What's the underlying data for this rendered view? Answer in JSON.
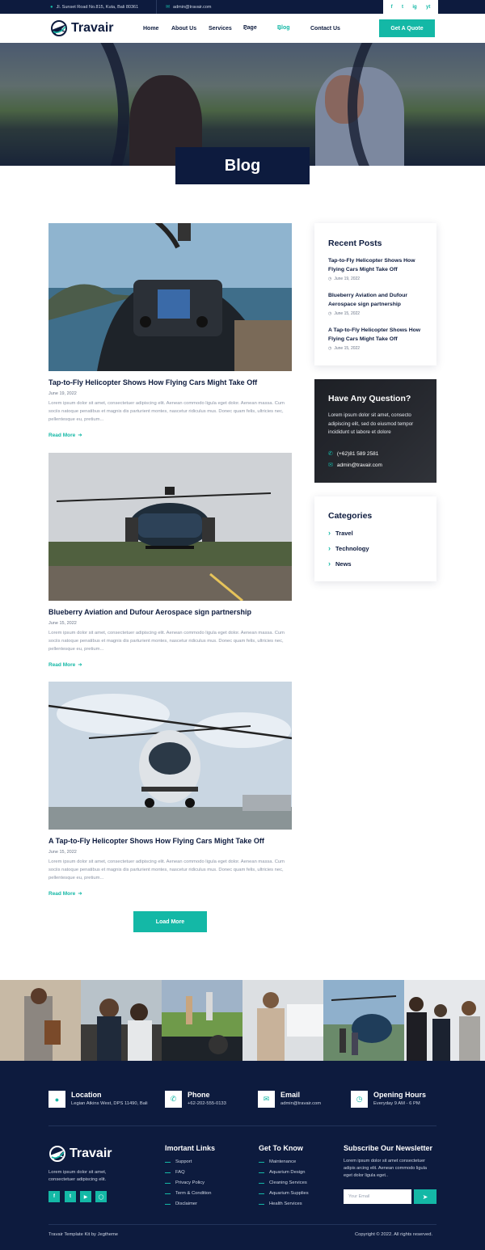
{
  "topbar": {
    "address": "Jl. Sunset Road No.815, Kuta, Bali 80361",
    "email": "admin@travair.com",
    "social": [
      "f",
      "t",
      "ig",
      "yt"
    ]
  },
  "nav": {
    "logo": "Travair",
    "items": [
      "Home",
      "About Us",
      "Services",
      "Page",
      "Blog",
      "Contact Us"
    ],
    "active": "Blog",
    "quote_button": "Get A Quote"
  },
  "hero": {
    "title": "Blog"
  },
  "posts": [
    {
      "title": "Tap-to-Fly Helicopter Shows How Flying Cars Might Take Off",
      "date": "June 19, 2022",
      "excerpt": "Lorem ipsum dolor sit amet, consectetuer adipiscing elit. Aenean commodo ligula eget dolor. Aenean massa. Cum sociis natoque penatibus et magnis dis parturient montes, nascetur ridiculus mus. Donec quam felis, ultricies nec, pellentesque eu, pretium...",
      "read_more": "Read More"
    },
    {
      "title": "Blueberry Aviation and Dufour Aerospace sign partnership",
      "date": "June 15, 2022",
      "excerpt": "Lorem ipsum dolor sit amet, consectetuer adipiscing elit. Aenean commodo ligula eget dolor. Aenean massa. Cum sociis natoque penatibus et magnis dis parturient montes, nascetur ridiculus mus. Donec quam felis, ultricies nec, pellentesque eu, pretium...",
      "read_more": "Read More"
    },
    {
      "title": "A Tap-to-Fly Helicopter Shows How Flying Cars Might Take Off",
      "date": "June 15, 2022",
      "excerpt": "Lorem ipsum dolor sit amet, consectetuer adipiscing elit. Aenean commodo ligula eget dolor. Aenean massa. Cum sociis natoque penatibus et magnis dis parturient montes, nascetur ridiculus mus. Donec quam felis, ultricies nec, pellentesque eu, pretium...",
      "read_more": "Read More"
    }
  ],
  "load_more": "Load More",
  "sidebar": {
    "recent_title": "Recent Posts",
    "recent": [
      {
        "title": "Tap-to-Fly Helicopter Shows How Flying Cars Might Take Off",
        "date": "June 19, 2022"
      },
      {
        "title": "Blueberry Aviation and Dufour Aerospace sign partnership",
        "date": "June 15, 2022"
      },
      {
        "title": "A Tap-to-Fly Helicopter Shows How Flying Cars Might Take Off",
        "date": "June 15, 2022"
      }
    ],
    "question": {
      "title": "Have Any Question?",
      "text": "Lorem ipsum dolor sit amet, consecto adipiscing elit, sed do eiusmod tempor incididunt ut labore et dolore",
      "phone": "(+62)81 589 2581",
      "email": "admin@travair.com"
    },
    "categories_title": "Categories",
    "categories": [
      "Travel",
      "Technology",
      "News"
    ]
  },
  "footer": {
    "info": [
      {
        "title": "Location",
        "text": "Legian Atkins West, DPS 11490, Bali",
        "icon": "location-icon"
      },
      {
        "title": "Phone",
        "text": "+62-202-555-0133",
        "icon": "phone-icon"
      },
      {
        "title": "Email",
        "text": "admin@travair.com",
        "icon": "mail-icon"
      },
      {
        "title": "Opening Hours",
        "text": "Everyday 9 AM - 6 PM",
        "icon": "clock-icon"
      }
    ],
    "logo": "Travair",
    "about": "Lorem ipsum dolor sit amet, consectetuer adipiscing elit.",
    "links_title": "Imortant Links",
    "links": [
      "Support",
      "FAQ",
      "Privacy Policy",
      "Term & Condition",
      "Disclaimer"
    ],
    "know_title": "Get To Know",
    "know": [
      "Maintenance",
      "Aquarium Design",
      "Cleaning Services",
      "Aquarium Supplies",
      "Health Services"
    ],
    "newsletter_title": "Subscribe Our Newsletter",
    "newsletter_text": "Lorem ipsum dolor sit amet consectetuer adipis arcing elit. Aenean commodo ligula eget dolor ligula eget..",
    "email_placeholder": "Your Email",
    "credit": "Travair Template Kit by Jegtheme",
    "copyright": "Copyright © 2022. All rights reserved."
  },
  "colors": {
    "accent": "#14b8a6",
    "navy": "#0d1b3e"
  }
}
